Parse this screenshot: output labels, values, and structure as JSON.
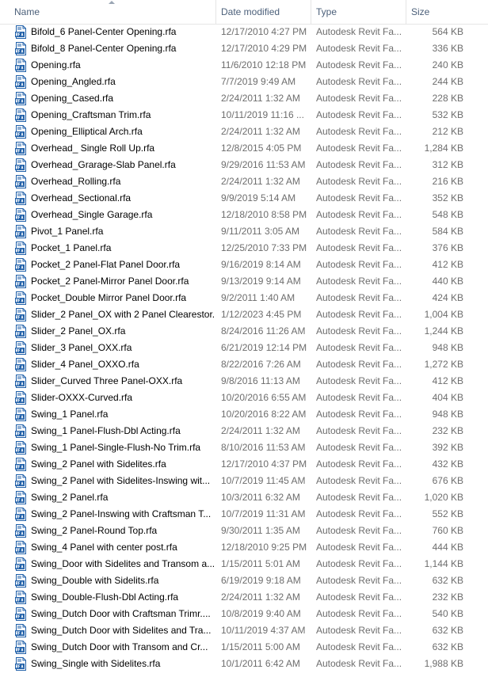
{
  "columns": {
    "name": "Name",
    "date": "Date modified",
    "type": "Type",
    "size": "Size"
  },
  "icons": {
    "file": "rfa-file-icon"
  },
  "colors": {
    "icon_blue": "#1f5fa8",
    "name_text": "#000000",
    "meta_text": "#6d6d6d"
  },
  "files": [
    {
      "name": "Bifold_6 Panel-Center Opening.rfa",
      "date": "12/17/2010 4:27 PM",
      "type": "Autodesk Revit Fa...",
      "size": "564 KB"
    },
    {
      "name": "Bifold_8 Panel-Center Opening.rfa",
      "date": "12/17/2010 4:29 PM",
      "type": "Autodesk Revit Fa...",
      "size": "336 KB"
    },
    {
      "name": "Opening.rfa",
      "date": "11/6/2010 12:18 PM",
      "type": "Autodesk Revit Fa...",
      "size": "240 KB"
    },
    {
      "name": "Opening_Angled.rfa",
      "date": "7/7/2019 9:49 AM",
      "type": "Autodesk Revit Fa...",
      "size": "244 KB"
    },
    {
      "name": "Opening_Cased.rfa",
      "date": "2/24/2011 1:32 AM",
      "type": "Autodesk Revit Fa...",
      "size": "228 KB"
    },
    {
      "name": "Opening_Craftsman Trim.rfa",
      "date": "10/11/2019 11:16 ...",
      "type": "Autodesk Revit Fa...",
      "size": "532 KB"
    },
    {
      "name": "Opening_Elliptical Arch.rfa",
      "date": "2/24/2011 1:32 AM",
      "type": "Autodesk Revit Fa...",
      "size": "212 KB"
    },
    {
      "name": "Overhead_ Single Roll Up.rfa",
      "date": "12/8/2015 4:05 PM",
      "type": "Autodesk Revit Fa...",
      "size": "1,284 KB"
    },
    {
      "name": "Overhead_Grarage-Slab Panel.rfa",
      "date": "9/29/2016 11:53 AM",
      "type": "Autodesk Revit Fa...",
      "size": "312 KB"
    },
    {
      "name": "Overhead_Rolling.rfa",
      "date": "2/24/2011 1:32 AM",
      "type": "Autodesk Revit Fa...",
      "size": "216 KB"
    },
    {
      "name": "Overhead_Sectional.rfa",
      "date": "9/9/2019 5:14 AM",
      "type": "Autodesk Revit Fa...",
      "size": "352 KB"
    },
    {
      "name": "Overhead_Single Garage.rfa",
      "date": "12/18/2010 8:58 PM",
      "type": "Autodesk Revit Fa...",
      "size": "548 KB"
    },
    {
      "name": "Pivot_1 Panel.rfa",
      "date": "9/11/2011 3:05 AM",
      "type": "Autodesk Revit Fa...",
      "size": "584 KB"
    },
    {
      "name": "Pocket_1 Panel.rfa",
      "date": "12/25/2010 7:33 PM",
      "type": "Autodesk Revit Fa...",
      "size": "376 KB"
    },
    {
      "name": "Pocket_2 Panel-Flat Panel Door.rfa",
      "date": "9/16/2019 8:14 AM",
      "type": "Autodesk Revit Fa...",
      "size": "412 KB"
    },
    {
      "name": "Pocket_2 Panel-Mirror Panel Door.rfa",
      "date": "9/13/2019 9:14 AM",
      "type": "Autodesk Revit Fa...",
      "size": "440 KB"
    },
    {
      "name": "Pocket_Double Mirror Panel Door.rfa",
      "date": "9/2/2011 1:40 AM",
      "type": "Autodesk Revit Fa...",
      "size": "424 KB"
    },
    {
      "name": "Slider_2 Panel_OX with 2 Panel Clearestor...",
      "date": "1/12/2023 4:45 PM",
      "type": "Autodesk Revit Fa...",
      "size": "1,004 KB"
    },
    {
      "name": "Slider_2 Panel_OX.rfa",
      "date": "8/24/2016 11:26 AM",
      "type": "Autodesk Revit Fa...",
      "size": "1,244 KB"
    },
    {
      "name": "Slider_3 Panel_OXX.rfa",
      "date": "6/21/2019 12:14 PM",
      "type": "Autodesk Revit Fa...",
      "size": "948 KB"
    },
    {
      "name": "Slider_4 Panel_OXXO.rfa",
      "date": "8/22/2016 7:26 AM",
      "type": "Autodesk Revit Fa...",
      "size": "1,272 KB"
    },
    {
      "name": "Slider_Curved Three Panel-OXX.rfa",
      "date": "9/8/2016 11:13 AM",
      "type": "Autodesk Revit Fa...",
      "size": "412 KB"
    },
    {
      "name": "Slider-OXXX-Curved.rfa",
      "date": "10/20/2016 6:55 AM",
      "type": "Autodesk Revit Fa...",
      "size": "404 KB"
    },
    {
      "name": "Swing_1 Panel.rfa",
      "date": "10/20/2016 8:22 AM",
      "type": "Autodesk Revit Fa...",
      "size": "948 KB"
    },
    {
      "name": "Swing_1 Panel-Flush-Dbl Acting.rfa",
      "date": "2/24/2011 1:32 AM",
      "type": "Autodesk Revit Fa...",
      "size": "232 KB"
    },
    {
      "name": "Swing_1 Panel-Single-Flush-No Trim.rfa",
      "date": "8/10/2016 11:53 AM",
      "type": "Autodesk Revit Fa...",
      "size": "392 KB"
    },
    {
      "name": "Swing_2 Panel with Sidelites.rfa",
      "date": "12/17/2010 4:37 PM",
      "type": "Autodesk Revit Fa...",
      "size": "432 KB"
    },
    {
      "name": "Swing_2 Panel with Sidelites-Inswing wit...",
      "date": "10/7/2019 11:45 AM",
      "type": "Autodesk Revit Fa...",
      "size": "676 KB"
    },
    {
      "name": "Swing_2 Panel.rfa",
      "date": "10/3/2011 6:32 AM",
      "type": "Autodesk Revit Fa...",
      "size": "1,020 KB"
    },
    {
      "name": "Swing_2 Panel-Inswing with Craftsman T...",
      "date": "10/7/2019 11:31 AM",
      "type": "Autodesk Revit Fa...",
      "size": "552 KB"
    },
    {
      "name": "Swing_2 Panel-Round Top.rfa",
      "date": "9/30/2011 1:35 AM",
      "type": "Autodesk Revit Fa...",
      "size": "760 KB"
    },
    {
      "name": "Swing_4 Panel with center post.rfa",
      "date": "12/18/2010 9:25 PM",
      "type": "Autodesk Revit Fa...",
      "size": "444 KB"
    },
    {
      "name": "Swing_Door with Sidelites and Transom a...",
      "date": "1/15/2011 5:01 AM",
      "type": "Autodesk Revit Fa...",
      "size": "1,144 KB"
    },
    {
      "name": "Swing_Double with Sidelits.rfa",
      "date": "6/19/2019 9:18 AM",
      "type": "Autodesk Revit Fa...",
      "size": "632 KB"
    },
    {
      "name": "Swing_Double-Flush-Dbl Acting.rfa",
      "date": "2/24/2011 1:32 AM",
      "type": "Autodesk Revit Fa...",
      "size": "232 KB"
    },
    {
      "name": "Swing_Dutch Door with Craftsman Trimr....",
      "date": "10/8/2019 9:40 AM",
      "type": "Autodesk Revit Fa...",
      "size": "540 KB"
    },
    {
      "name": "Swing_Dutch Door with Sidelites and Tra...",
      "date": "10/11/2019 4:37 AM",
      "type": "Autodesk Revit Fa...",
      "size": "632 KB"
    },
    {
      "name": "Swing_Dutch Door with Transom and Cr...",
      "date": "1/15/2011 5:00 AM",
      "type": "Autodesk Revit Fa...",
      "size": "632 KB"
    },
    {
      "name": "Swing_Single with Sidelites.rfa",
      "date": "10/1/2011 6:42 AM",
      "type": "Autodesk Revit Fa...",
      "size": "1,988 KB"
    }
  ]
}
